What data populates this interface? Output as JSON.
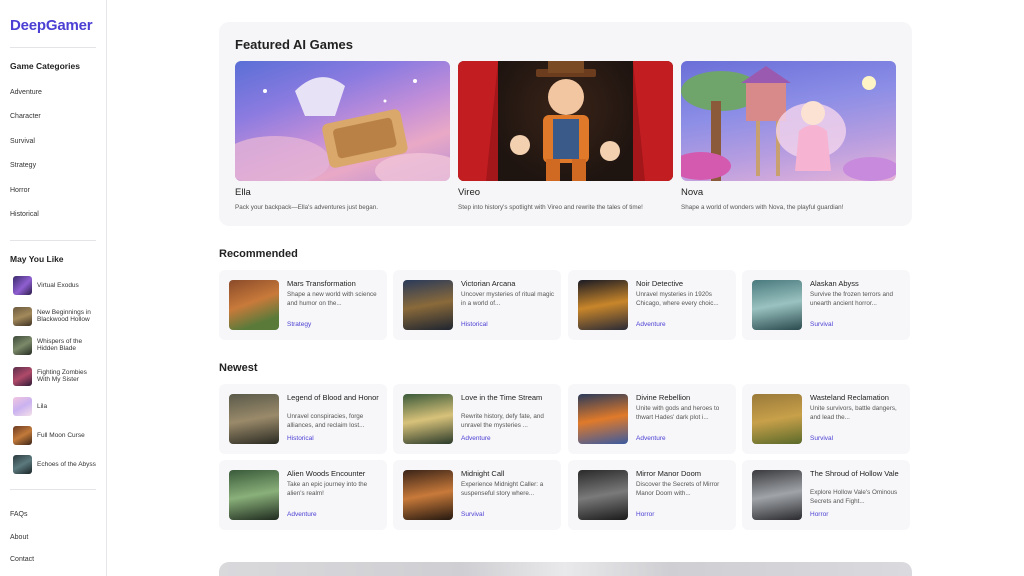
{
  "brand": {
    "name": "DeepGamer",
    "color": "#4b3fd4"
  },
  "sidebar": {
    "categories_heading": "Game Categories",
    "categories": [
      "Adventure",
      "Character",
      "Survival",
      "Strategy",
      "Horror",
      "Historical"
    ],
    "may_you_like_heading": "May You Like",
    "may_you_like": [
      {
        "label": "Virtual Exodus"
      },
      {
        "label": "New Beginnings in Blackwood Hollow"
      },
      {
        "label": "Whispers of the Hidden Blade"
      },
      {
        "label": "Fighting Zombies With My Sister"
      },
      {
        "label": "Lila"
      },
      {
        "label": "Full Moon Curse"
      },
      {
        "label": "Echoes of the Abyss"
      }
    ],
    "footer_links": [
      "FAQs",
      "About",
      "Contact"
    ]
  },
  "featured": {
    "title": "Featured AI Games",
    "cards": [
      {
        "name": "Ella",
        "desc": "Pack your backpack—Ella's adventures just began."
      },
      {
        "name": "Vireo",
        "desc": "Step into history's spotlight with Vireo and rewrite the tales of time!"
      },
      {
        "name": "Nova",
        "desc": "Shape a world of wonders with Nova, the playful guardian!"
      }
    ]
  },
  "recommended": {
    "title": "Recommended",
    "cards": [
      {
        "title": "Mars Transformation",
        "desc": "Shape a new world with science and humor on the...",
        "tag": "Strategy"
      },
      {
        "title": "Victorian Arcana",
        "desc": "Uncover mysteries of ritual magic in a world of...",
        "tag": "Historical"
      },
      {
        "title": "Noir Detective",
        "desc": "Unravel mysteries in 1920s Chicago, where every choic...",
        "tag": "Adventure"
      },
      {
        "title": "Alaskan Abyss",
        "desc": "Survive the frozen terrors and unearth ancient horror...",
        "tag": "Survival"
      }
    ]
  },
  "newest": {
    "title": "Newest",
    "cards": [
      {
        "title": "Legend of Blood and Honor",
        "desc": "Unravel conspiracies, forge alliances, and reclaim lost...",
        "tag": "Historical"
      },
      {
        "title": "Love in the Time Stream",
        "desc": "Rewrite history, defy fate, and unravel the mysteries ...",
        "tag": "Adventure"
      },
      {
        "title": "Divine Rebellion",
        "desc": "Unite with gods and heroes to thwart Hades' dark plot i...",
        "tag": "Adventure"
      },
      {
        "title": "Wasteland Reclamation",
        "desc": "Unite survivors, battle dangers, and lead the...",
        "tag": "Survival"
      },
      {
        "title": "Alien Woods Encounter",
        "desc": "Take an epic journey into the alien's realm!",
        "tag": "Adventure"
      },
      {
        "title": "Midnight Call",
        "desc": "Experience Midnight Caller: a suspenseful story where...",
        "tag": "Survival"
      },
      {
        "title": "Mirror Manor Doom",
        "desc": "Discover the Secrets of Mirror Manor Doom with...",
        "tag": "Horror"
      },
      {
        "title": "The Shroud of Hollow Vale",
        "desc": "Explore Hollow Vale's Ominous Secrets and Fight...",
        "tag": "Horror"
      }
    ]
  }
}
